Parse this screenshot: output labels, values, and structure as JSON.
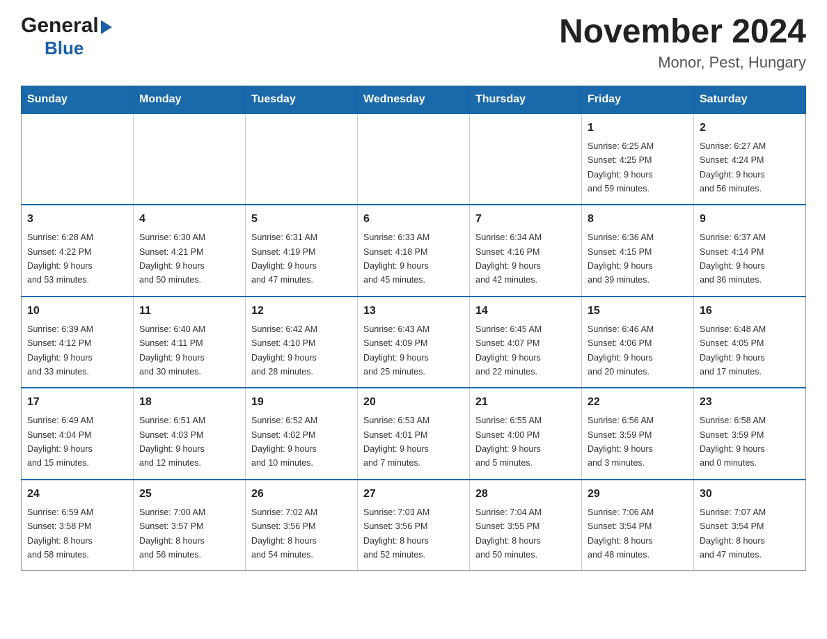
{
  "logo": {
    "general": "General",
    "blue": "Blue",
    "arrow": "▶"
  },
  "title": "November 2024",
  "subtitle": "Monor, Pest, Hungary",
  "weekdays": [
    "Sunday",
    "Monday",
    "Tuesday",
    "Wednesday",
    "Thursday",
    "Friday",
    "Saturday"
  ],
  "weeks": [
    [
      {
        "day": "",
        "info": ""
      },
      {
        "day": "",
        "info": ""
      },
      {
        "day": "",
        "info": ""
      },
      {
        "day": "",
        "info": ""
      },
      {
        "day": "",
        "info": ""
      },
      {
        "day": "1",
        "info": "Sunrise: 6:25 AM\nSunset: 4:25 PM\nDaylight: 9 hours\nand 59 minutes."
      },
      {
        "day": "2",
        "info": "Sunrise: 6:27 AM\nSunset: 4:24 PM\nDaylight: 9 hours\nand 56 minutes."
      }
    ],
    [
      {
        "day": "3",
        "info": "Sunrise: 6:28 AM\nSunset: 4:22 PM\nDaylight: 9 hours\nand 53 minutes."
      },
      {
        "day": "4",
        "info": "Sunrise: 6:30 AM\nSunset: 4:21 PM\nDaylight: 9 hours\nand 50 minutes."
      },
      {
        "day": "5",
        "info": "Sunrise: 6:31 AM\nSunset: 4:19 PM\nDaylight: 9 hours\nand 47 minutes."
      },
      {
        "day": "6",
        "info": "Sunrise: 6:33 AM\nSunset: 4:18 PM\nDaylight: 9 hours\nand 45 minutes."
      },
      {
        "day": "7",
        "info": "Sunrise: 6:34 AM\nSunset: 4:16 PM\nDaylight: 9 hours\nand 42 minutes."
      },
      {
        "day": "8",
        "info": "Sunrise: 6:36 AM\nSunset: 4:15 PM\nDaylight: 9 hours\nand 39 minutes."
      },
      {
        "day": "9",
        "info": "Sunrise: 6:37 AM\nSunset: 4:14 PM\nDaylight: 9 hours\nand 36 minutes."
      }
    ],
    [
      {
        "day": "10",
        "info": "Sunrise: 6:39 AM\nSunset: 4:12 PM\nDaylight: 9 hours\nand 33 minutes."
      },
      {
        "day": "11",
        "info": "Sunrise: 6:40 AM\nSunset: 4:11 PM\nDaylight: 9 hours\nand 30 minutes."
      },
      {
        "day": "12",
        "info": "Sunrise: 6:42 AM\nSunset: 4:10 PM\nDaylight: 9 hours\nand 28 minutes."
      },
      {
        "day": "13",
        "info": "Sunrise: 6:43 AM\nSunset: 4:09 PM\nDaylight: 9 hours\nand 25 minutes."
      },
      {
        "day": "14",
        "info": "Sunrise: 6:45 AM\nSunset: 4:07 PM\nDaylight: 9 hours\nand 22 minutes."
      },
      {
        "day": "15",
        "info": "Sunrise: 6:46 AM\nSunset: 4:06 PM\nDaylight: 9 hours\nand 20 minutes."
      },
      {
        "day": "16",
        "info": "Sunrise: 6:48 AM\nSunset: 4:05 PM\nDaylight: 9 hours\nand 17 minutes."
      }
    ],
    [
      {
        "day": "17",
        "info": "Sunrise: 6:49 AM\nSunset: 4:04 PM\nDaylight: 9 hours\nand 15 minutes."
      },
      {
        "day": "18",
        "info": "Sunrise: 6:51 AM\nSunset: 4:03 PM\nDaylight: 9 hours\nand 12 minutes."
      },
      {
        "day": "19",
        "info": "Sunrise: 6:52 AM\nSunset: 4:02 PM\nDaylight: 9 hours\nand 10 minutes."
      },
      {
        "day": "20",
        "info": "Sunrise: 6:53 AM\nSunset: 4:01 PM\nDaylight: 9 hours\nand 7 minutes."
      },
      {
        "day": "21",
        "info": "Sunrise: 6:55 AM\nSunset: 4:00 PM\nDaylight: 9 hours\nand 5 minutes."
      },
      {
        "day": "22",
        "info": "Sunrise: 6:56 AM\nSunset: 3:59 PM\nDaylight: 9 hours\nand 3 minutes."
      },
      {
        "day": "23",
        "info": "Sunrise: 6:58 AM\nSunset: 3:59 PM\nDaylight: 9 hours\nand 0 minutes."
      }
    ],
    [
      {
        "day": "24",
        "info": "Sunrise: 6:59 AM\nSunset: 3:58 PM\nDaylight: 8 hours\nand 58 minutes."
      },
      {
        "day": "25",
        "info": "Sunrise: 7:00 AM\nSunset: 3:57 PM\nDaylight: 8 hours\nand 56 minutes."
      },
      {
        "day": "26",
        "info": "Sunrise: 7:02 AM\nSunset: 3:56 PM\nDaylight: 8 hours\nand 54 minutes."
      },
      {
        "day": "27",
        "info": "Sunrise: 7:03 AM\nSunset: 3:56 PM\nDaylight: 8 hours\nand 52 minutes."
      },
      {
        "day": "28",
        "info": "Sunrise: 7:04 AM\nSunset: 3:55 PM\nDaylight: 8 hours\nand 50 minutes."
      },
      {
        "day": "29",
        "info": "Sunrise: 7:06 AM\nSunset: 3:54 PM\nDaylight: 8 hours\nand 48 minutes."
      },
      {
        "day": "30",
        "info": "Sunrise: 7:07 AM\nSunset: 3:54 PM\nDaylight: 8 hours\nand 47 minutes."
      }
    ]
  ]
}
